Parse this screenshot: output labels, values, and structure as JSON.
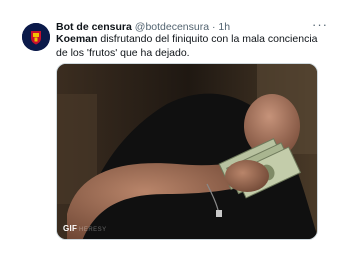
{
  "tweet": {
    "display_name": "Bot de censura",
    "handle": "@botdecensura",
    "separator": "·",
    "time": "1h",
    "more_icon": "···",
    "text_bold": "Koeman",
    "text_rest": " disfrutando del finiquito con la mala conciencia de los 'frutos' que ha dejado.",
    "media": {
      "badge": "GIF",
      "watermark": "HERESY"
    }
  },
  "colors": {
    "name": "#0f1419",
    "secondary": "#536471",
    "avatar_bg": "#0b1a4a",
    "avatar_emblem": "#c8102e"
  }
}
